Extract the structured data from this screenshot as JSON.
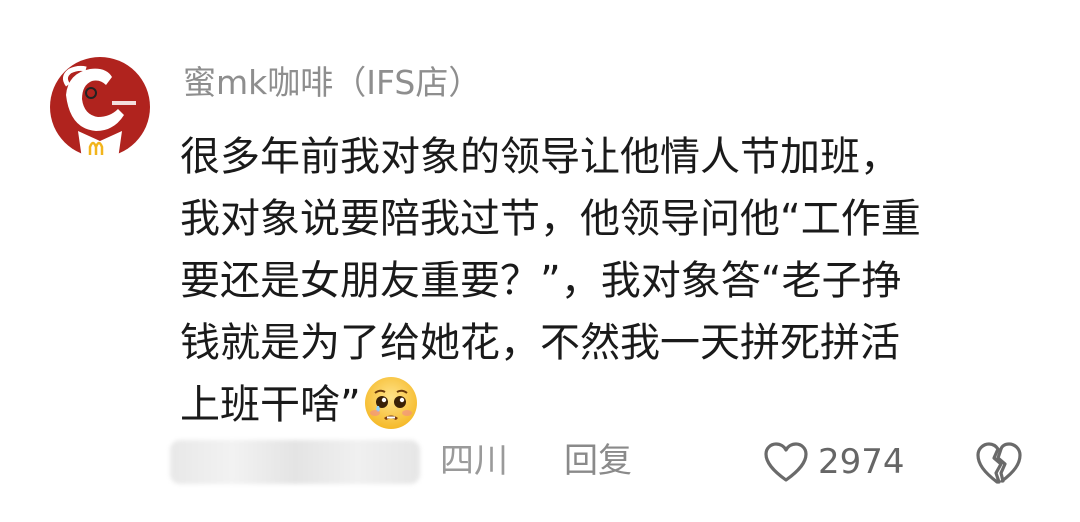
{
  "comment": {
    "username": "蜜mk咖啡（IFS店）",
    "text_lines": [
      "很多年前我对象的领导让他情人节加班，",
      "我对象说要陪我过节，他领导问他“工作重",
      "要还是女朋友重要？”，我对象答“老子挣",
      "钱就是为了给她花，不然我一天拼死拼活",
      "上班干啥”"
    ],
    "emoji": "pleading-face-emoji",
    "avatar": "kfc-mcdonalds-mashup-logo"
  },
  "footer": {
    "location": "四川",
    "reply_label": "回复",
    "like_count": "2974",
    "like_icon": "heart-outline-icon",
    "dislike_icon": "broken-heart-icon"
  },
  "colors": {
    "username": "#8e8e8e",
    "text": "#1a1a1a",
    "meta": "#9a9a9a",
    "avatar_red": "#a8201c"
  }
}
